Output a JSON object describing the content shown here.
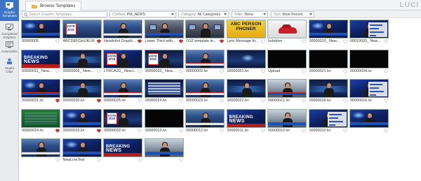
{
  "app": {
    "brand": "LUCI"
  },
  "sidebar": {
    "items": [
      {
        "label_1": "Graphic",
        "label_2": "Templates",
        "icon": "graphic-templates-icon",
        "active": true
      },
      {
        "label_1": "Completed",
        "label_2": "Graphics",
        "icon": "completed-graphics-icon",
        "active": false
      },
      {
        "label_1": "Automation",
        "label_2": "",
        "icon": "automation-icon",
        "active": false
      },
      {
        "label_1": "Studio",
        "label_2": "Clips",
        "icon": "studio-clips-icon",
        "active": false
      }
    ]
  },
  "tabs": [
    {
      "label": "Browse Templates",
      "icon": "folder-icon"
    }
  ],
  "filters": {
    "search_placeholder": "Search Graphic Templates...",
    "context_label": "Context:",
    "context_value": "PM_NEWS",
    "category_label": "Category:",
    "category_value": "All Categories",
    "filter_label": "Filter:",
    "filter_value": "None",
    "sort_label": "Sort:",
    "sort_value": "Most Recent"
  },
  "templates": [
    {
      "name": "00000005",
      "thumb": "anchor-blue",
      "favorite": false
    },
    {
      "name": "ABCDEFGHIJKLM...",
      "thumb": "studio-vote",
      "favorite": true
    },
    {
      "name": "Headshot Graphi...",
      "thumb": "anchor-lower",
      "favorite": true
    },
    {
      "name": "Lower Third with...",
      "thumb": "desk",
      "favorite": true
    },
    {
      "name": "GS2 template te...",
      "thumb": "desk-wide",
      "favorite": true
    },
    {
      "name": "Lyric Message fo...",
      "thumb": "abc-person",
      "favorite": false
    },
    {
      "name": "hsbdrive",
      "thumb": "car",
      "favorite": false
    },
    {
      "name": "00000010_ New...",
      "thumb": "anchor-blue",
      "favorite": false
    },
    {
      "name": "00010020_ New...",
      "thumb": "poll",
      "favorite": false
    },
    {
      "name": "00000011_ New...",
      "thumb": "breaking",
      "favorite": false
    },
    {
      "name": "00000006_ New...",
      "thumb": "studio-blue",
      "favorite": false
    },
    {
      "name": "LYRCA2D_ New.t...",
      "thumb": "vote",
      "favorite": false
    },
    {
      "name": "00000032_ New...",
      "thumb": "vote-studio",
      "favorite": false
    },
    {
      "name": "00000002.lvr",
      "thumb": "anchor-lower",
      "favorite": false
    },
    {
      "name": "00000001.lvr",
      "thumb": "night-studio",
      "favorite": false
    },
    {
      "name": "Upload",
      "thumb": "black",
      "favorite": false
    },
    {
      "name": "00000021.lvr",
      "thumb": "black",
      "favorite": false
    },
    {
      "name": "00000034.lvr",
      "thumb": "black",
      "favorite": false
    },
    {
      "name": "00000031.lvr",
      "thumb": "anchor-blue",
      "favorite": true
    },
    {
      "name": "00000030.lvr",
      "thumb": "studio-blue",
      "favorite": true
    },
    {
      "name": "00000025.lvr",
      "thumb": "anchor-lower",
      "favorite": false
    },
    {
      "name": "00000024.lvr",
      "thumb": "monitors",
      "favorite": false
    },
    {
      "name": "00000023.lvr",
      "thumb": "anchor-lower",
      "favorite": false
    },
    {
      "name": "00000022.lvr",
      "thumb": "studio-blue",
      "favorite": false
    },
    {
      "name": "00000021.lvr",
      "thumb": "studio-bright",
      "favorite": false
    },
    {
      "name": "00000018.lvr",
      "thumb": "studio-blue",
      "favorite": false
    },
    {
      "name": "00000016.lvr",
      "thumb": "poll",
      "favorite": false
    },
    {
      "name": "00000014.lvr",
      "thumb": "green",
      "favorite": true
    },
    {
      "name": "00000033.lvr",
      "thumb": "anchor-blue",
      "favorite": true
    },
    {
      "name": "00000032.lvr",
      "thumb": "vote-studio",
      "favorite": false
    },
    {
      "name": "00000013.lvr",
      "thumb": "black",
      "favorite": false
    },
    {
      "name": "00000012.lvr",
      "thumb": "anchor-lower",
      "favorite": false
    },
    {
      "name": "00000011.lvr",
      "thumb": "breaking",
      "favorite": false
    },
    {
      "name": "00000010.lvr",
      "thumb": "studio-bright",
      "favorite": false
    },
    {
      "name": "00000010.lvr",
      "thumb": "poll",
      "favorite": false
    },
    {
      "name": "",
      "thumb": "anchor-blue",
      "favorite": false
    },
    {
      "name": "",
      "thumb": "anchor-lower",
      "favorite": false
    },
    {
      "name": "NewLineTest",
      "thumb": "anchor-blue",
      "favorite": false
    },
    {
      "name": "",
      "thumb": "breaking-news",
      "favorite": false
    },
    {
      "name": "",
      "thumb": "studio-bright",
      "favorite": false
    }
  ],
  "thumb_text": {
    "breaking_1": "BREAKING",
    "breaking_2": "NEWS",
    "vote_1": "VOTE",
    "vote_2": "2016",
    "abc_1": "ABC PERSON",
    "abc_2": "PHONER"
  },
  "colors": {
    "accent": "#3a73c8",
    "heart_active": "#c0392b",
    "heart_inactive": "#b9bdc4"
  }
}
